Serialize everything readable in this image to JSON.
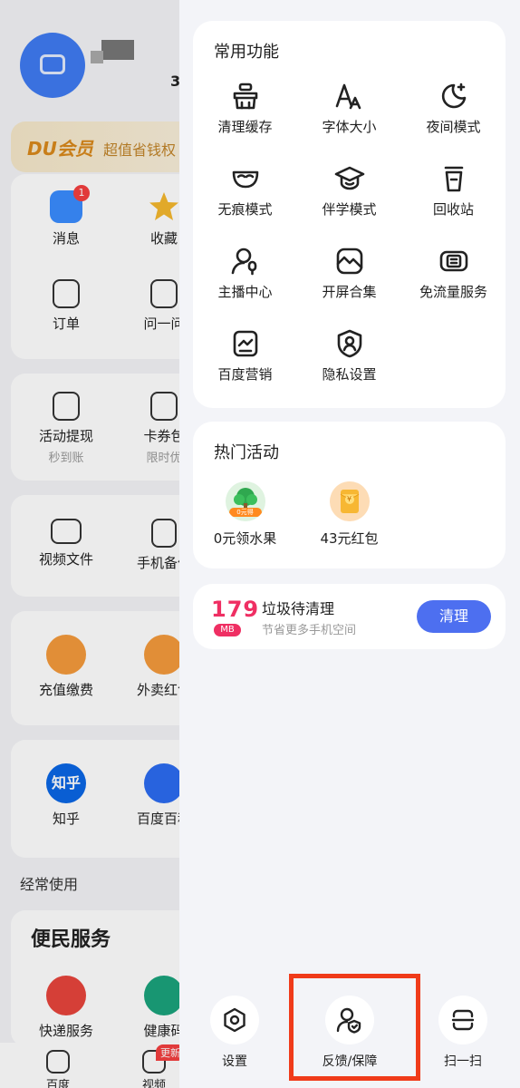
{
  "background_page": {
    "vip_logo": "DU会员",
    "vip_subtitle": "超值省钱权",
    "header_number": "3",
    "grid1": [
      {
        "label": "消息",
        "badge": "1"
      },
      {
        "label": "收藏"
      },
      {
        "label": "订单"
      },
      {
        "label": "问一问"
      }
    ],
    "grid2": [
      {
        "label": "活动提现",
        "sub": "秒到账"
      },
      {
        "label": "卡券包",
        "sub": "限时优"
      }
    ],
    "grid3": [
      {
        "label": "视频文件"
      },
      {
        "label": "手机备份"
      }
    ],
    "grid4": [
      {
        "label": "充值缴费"
      },
      {
        "label": "外卖红包"
      }
    ],
    "grid5": [
      {
        "label": "知乎",
        "icon_text": "知乎"
      },
      {
        "label": "百度百科"
      }
    ],
    "section_frequent": "经常使用",
    "service_title": "便民服务",
    "services": [
      {
        "label": "快递服务"
      },
      {
        "label": "健康码"
      }
    ],
    "bottom_nav": [
      {
        "label": "百度"
      },
      {
        "label": "视频"
      }
    ],
    "update_tag": "更新"
  },
  "drawer": {
    "common_title": "常用功能",
    "functions": [
      {
        "label": "清理缓存",
        "icon": "broom-icon"
      },
      {
        "label": "字体大小",
        "icon": "font-size-icon"
      },
      {
        "label": "夜间模式",
        "icon": "moon-icon"
      },
      {
        "label": "无痕模式",
        "icon": "mask-icon"
      },
      {
        "label": "伴学模式",
        "icon": "graduation-cap-icon"
      },
      {
        "label": "回收站",
        "icon": "trash-icon"
      },
      {
        "label": "主播中心",
        "icon": "streamer-icon"
      },
      {
        "label": "开屏合集",
        "icon": "gallery-icon"
      },
      {
        "label": "免流量服务",
        "icon": "data-free-icon"
      },
      {
        "label": "百度营销",
        "icon": "marketing-icon"
      },
      {
        "label": "隐私设置",
        "icon": "privacy-shield-icon"
      }
    ],
    "hot_title": "热门活动",
    "activities": [
      {
        "label": "0元领水果",
        "tag": "0元得"
      },
      {
        "label": "43元红包",
        "tag": "¥"
      }
    ],
    "clean": {
      "number": "179",
      "unit": "MB",
      "title": "垃圾待清理",
      "subtitle": "节省更多手机空间",
      "button": "清理"
    },
    "bottom_actions": [
      {
        "label": "设置",
        "icon": "settings-hexagon-icon"
      },
      {
        "label": "反馈/保障",
        "icon": "feedback-shield-icon"
      },
      {
        "label": "扫一扫",
        "icon": "scan-icon"
      }
    ]
  },
  "colors": {
    "accent_blue": "#4d6ff0",
    "clean_red": "#ef2f63",
    "highlight_box": "#f03b1a",
    "drawer_bg": "#f3f4f8"
  }
}
